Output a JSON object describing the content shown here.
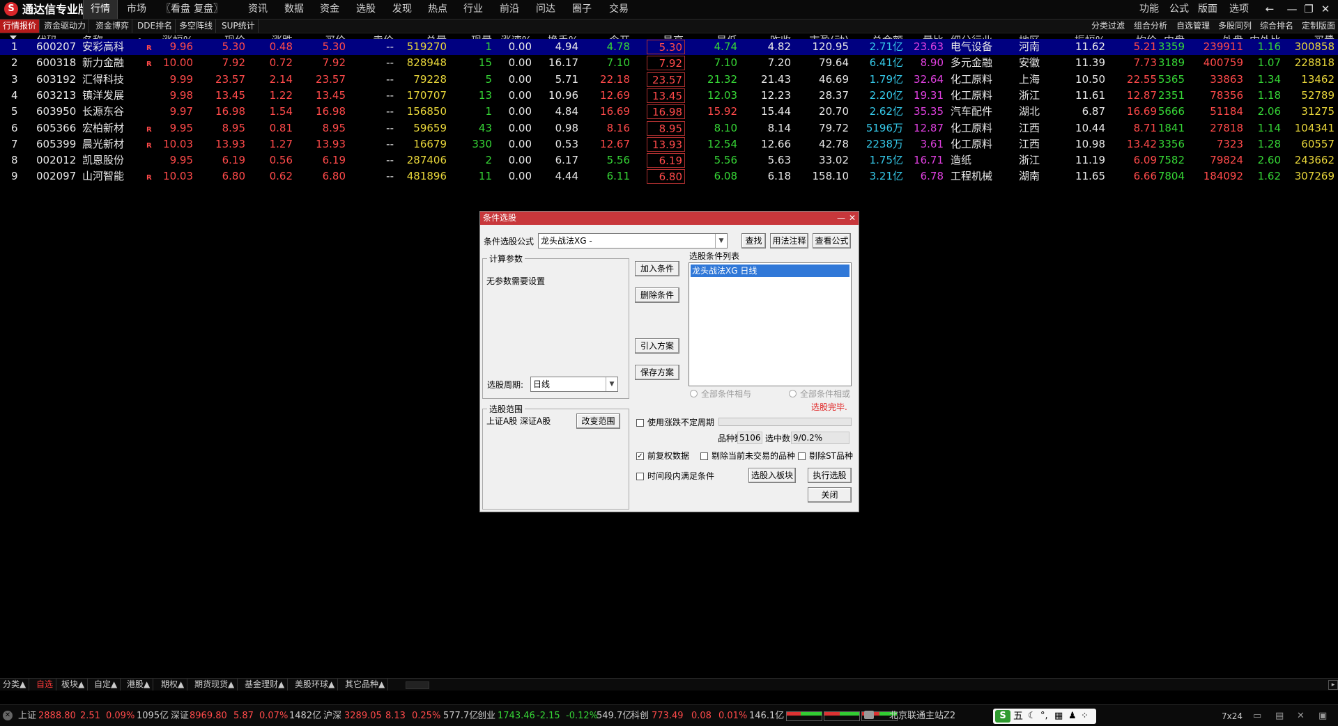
{
  "app": {
    "logo": "S",
    "title": "通达信专业版"
  },
  "menu": [
    "行情",
    "市场",
    "〖看盘",
    "复盘〗",
    "资讯",
    "数据",
    "资金",
    "选股",
    "发现",
    "热点",
    "行业",
    "前沿",
    "问达",
    "圈子",
    "交易"
  ],
  "right_menu": [
    "功能",
    "公式",
    "版面",
    "选项"
  ],
  "window_controls": [
    "←",
    "—",
    "❐",
    "✕"
  ],
  "subtabs": [
    "行情报价",
    "资金驱动力",
    "资金博弈",
    "DDE排名",
    "多空阵线",
    "SUP统计"
  ],
  "right_subtabs": [
    "分类过滤",
    "组合分析",
    "自选管理",
    "多股同列",
    "综合排名",
    "定制版面"
  ],
  "columns": [
    "代码",
    "名称",
    "•",
    "涨幅%",
    "现价",
    "涨跌",
    "买价",
    "卖价",
    "总量",
    "现量",
    "涨速%",
    "换手%",
    "今开",
    "最高",
    "最低",
    "昨收",
    "市盈(动)",
    "总金额",
    "量比",
    "细分行业",
    "地区",
    "振幅%",
    "均价",
    "内盘",
    "外盘",
    "内外比",
    "买量"
  ],
  "rows": [
    [
      "1",
      "600207",
      "安彩高科",
      "R",
      "9.96",
      "5.30",
      "0.48",
      "5.30",
      "--",
      "519270",
      "1",
      "0.00",
      "4.94",
      "4.78",
      "5.30",
      "4.74",
      "4.82",
      "120.95",
      "2.71亿",
      "23.63",
      "电气设备",
      "河南",
      "11.62",
      "5.21",
      "3359",
      "239911",
      "1.16",
      "300858"
    ],
    [
      "2",
      "600318",
      "新力金融",
      "R",
      "10.00",
      "7.92",
      "0.72",
      "7.92",
      "--",
      "828948",
      "15",
      "0.00",
      "16.17",
      "7.10",
      "7.92",
      "7.10",
      "7.20",
      "79.64",
      "6.41亿",
      "8.90",
      "多元金融",
      "安徽",
      "11.39",
      "7.73",
      "3189",
      "400759",
      "1.07",
      "228818"
    ],
    [
      "3",
      "603192",
      "汇得科技",
      "",
      "9.99",
      "23.57",
      "2.14",
      "23.57",
      "--",
      "79228",
      "5",
      "0.00",
      "5.71",
      "22.18",
      "23.57",
      "21.32",
      "21.43",
      "46.69",
      "1.79亿",
      "32.64",
      "化工原料",
      "上海",
      "10.50",
      "22.55",
      "5365",
      "33863",
      "1.34",
      "13462"
    ],
    [
      "4",
      "603213",
      "镇洋发展",
      "",
      "9.98",
      "13.45",
      "1.22",
      "13.45",
      "--",
      "170707",
      "13",
      "0.00",
      "10.96",
      "12.69",
      "13.45",
      "12.03",
      "12.23",
      "28.37",
      "2.20亿",
      "19.31",
      "化工原料",
      "浙江",
      "11.61",
      "12.87",
      "2351",
      "78356",
      "1.18",
      "52789"
    ],
    [
      "5",
      "603950",
      "长源东谷",
      "",
      "9.97",
      "16.98",
      "1.54",
      "16.98",
      "--",
      "156850",
      "1",
      "0.00",
      "4.84",
      "16.69",
      "16.98",
      "15.92",
      "15.44",
      "20.70",
      "2.62亿",
      "35.35",
      "汽车配件",
      "湖北",
      "6.87",
      "16.69",
      "5666",
      "51184",
      "2.06",
      "31275"
    ],
    [
      "6",
      "605366",
      "宏柏新材",
      "R",
      "9.95",
      "8.95",
      "0.81",
      "8.95",
      "--",
      "59659",
      "43",
      "0.00",
      "0.98",
      "8.16",
      "8.95",
      "8.10",
      "8.14",
      "79.72",
      "5196万",
      "12.87",
      "化工原料",
      "江西",
      "10.44",
      "8.71",
      "1841",
      "27818",
      "1.14",
      "104341"
    ],
    [
      "7",
      "605399",
      "晨光新材",
      "R",
      "10.03",
      "13.93",
      "1.27",
      "13.93",
      "--",
      "16679",
      "330",
      "0.00",
      "0.53",
      "12.67",
      "13.93",
      "12.54",
      "12.66",
      "42.78",
      "2238万",
      "3.61",
      "化工原料",
      "江西",
      "10.98",
      "13.42",
      "3356",
      "7323",
      "1.28",
      "60557"
    ],
    [
      "8",
      "002012",
      "凯恩股份",
      "",
      "9.95",
      "6.19",
      "0.56",
      "6.19",
      "--",
      "287406",
      "2",
      "0.00",
      "6.17",
      "5.56",
      "6.19",
      "5.56",
      "5.63",
      "33.02",
      "1.75亿",
      "16.71",
      "造纸",
      "浙江",
      "11.19",
      "6.09",
      "7582",
      "79824",
      "2.60",
      "243662"
    ],
    [
      "9",
      "002097",
      "山河智能",
      "R",
      "10.03",
      "6.80",
      "0.62",
      "6.80",
      "--",
      "481896",
      "11",
      "0.00",
      "4.44",
      "6.11",
      "6.80",
      "6.08",
      "6.18",
      "158.10",
      "3.21亿",
      "6.78",
      "工程机械",
      "湖南",
      "11.65",
      "6.66",
      "7804",
      "184092",
      "1.62",
      "307269"
    ]
  ],
  "bottom_tabs": [
    "分类▲",
    "自选",
    "板块▲",
    "自定▲",
    "港股▲",
    "期权▲",
    "期货现货▲",
    "基金理财▲",
    "美股环球▲",
    "其它品种▲"
  ],
  "status": {
    "sh": {
      "label": "上证",
      "value": "2888.80",
      "chg": "2.51",
      "pct": "0.09%",
      "amt": "1095亿"
    },
    "sz": {
      "label": "深证",
      "value": "8969.80",
      "chg": "5.87",
      "pct": "0.07%",
      "amt": "1482亿"
    },
    "hs": {
      "label": "沪深",
      "value": "3289.05",
      "chg": "8.13",
      "pct": "0.25%",
      "amt": "577.7亿"
    },
    "cy": {
      "label": "创业",
      "value": "1743.46",
      "chg": "-2.15",
      "pct": "-0.12%",
      "amt": "549.7亿"
    },
    "kc": {
      "label": "科创",
      "value": "773.49",
      "chg": "0.08",
      "pct": "0.01%",
      "amt": "146.1亿"
    },
    "server": "北京联通主站Z2",
    "ime": "五",
    "time": "7x24"
  },
  "dialog": {
    "title": "条件选股",
    "formula_label": "条件选股公式",
    "formula_value": "龙头战法XG  -",
    "find_button": "查找",
    "usage_button": "用法注释",
    "view_formula_button": "查看公式",
    "params_group": "计算参数",
    "params_note": "无参数需要设置",
    "period_label": "选股周期:",
    "period_value": "日线",
    "add_condition": "加入条件",
    "delete_condition": "删除条件",
    "import_plan": "引入方案",
    "save_plan": "保存方案",
    "condition_list_label": "选股条件列表",
    "conditions": [
      "龙头战法XG  日线"
    ],
    "radio_and": "全部条件相与",
    "radio_or": "全部条件相或",
    "done_text": "选股完毕.",
    "range_group": "选股范围",
    "range_value": "上证A股 深证A股",
    "change_range": "改变范围",
    "uncertain_period": "使用涨跌不定周期",
    "count_label": "品种数",
    "count_value": "5106",
    "selected_label": "选中数",
    "selected_value": "9/0.2%",
    "pre_adjust": "前复权数据",
    "remove_untraded": "剔除当前未交易的品种",
    "remove_st": "剔除ST品种",
    "time_window": "时间段内满足条件",
    "to_block": "选股入板块",
    "execute": "执行选股",
    "close": "关闭"
  }
}
